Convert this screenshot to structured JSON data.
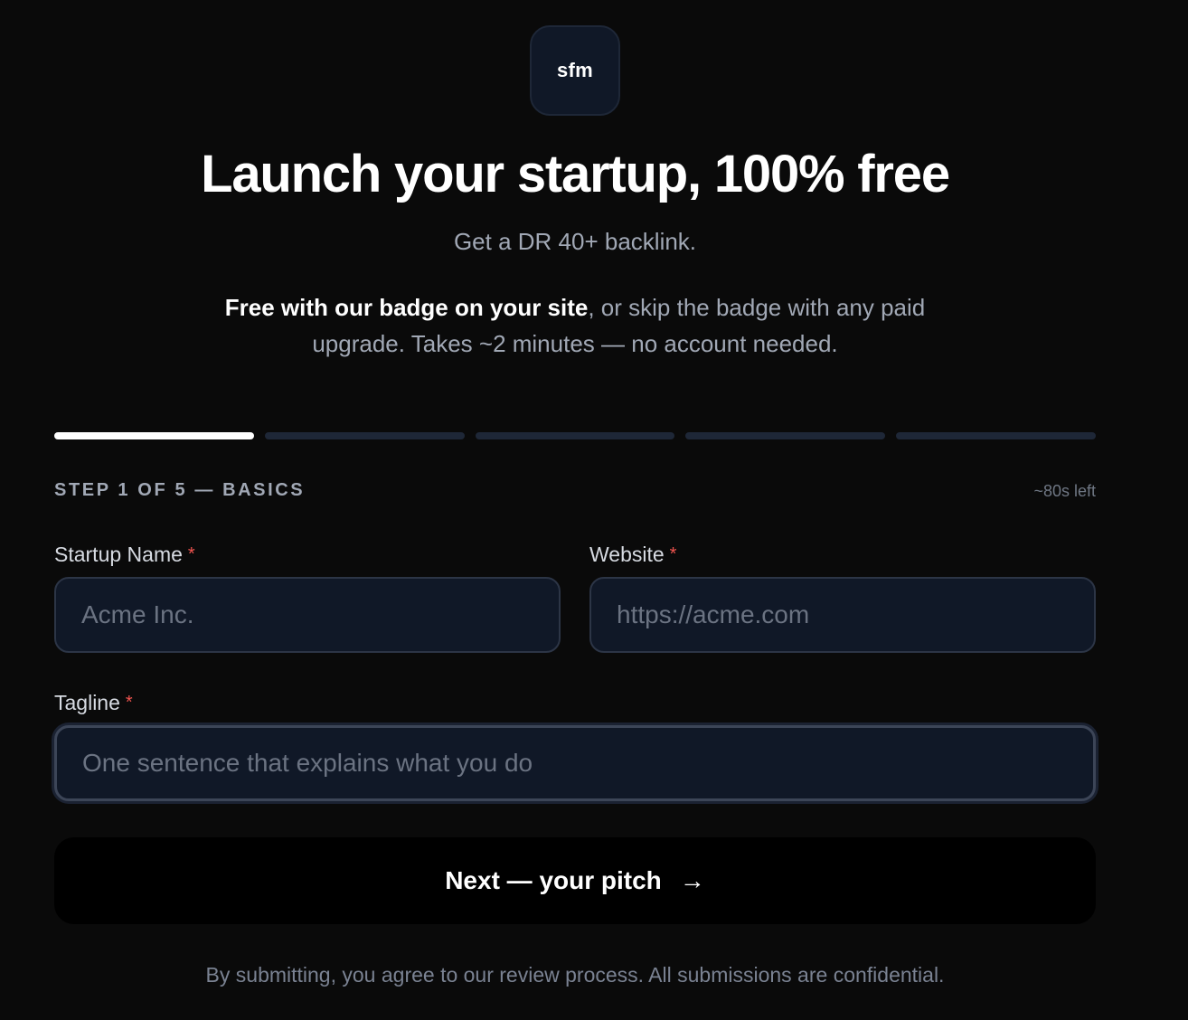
{
  "logo": {
    "text": "sfm"
  },
  "hero": {
    "headline": "Launch your startup, 100% free",
    "subhead": "Get a DR 40+ backlink.",
    "desc_strong": "Free with our badge on your site",
    "desc_rest": ", or skip the badge with any paid upgrade. Takes ~2 minutes — no account needed."
  },
  "progress": {
    "total_steps": 5,
    "current_step": 1
  },
  "step": {
    "label": "STEP 1 OF 5 — BASICS",
    "time_left": "~80s left"
  },
  "form": {
    "required_marker": "*",
    "startup_name": {
      "label": "Startup Name",
      "placeholder": "Acme Inc.",
      "value": ""
    },
    "website": {
      "label": "Website",
      "placeholder": "https://acme.com",
      "value": ""
    },
    "tagline": {
      "label": "Tagline",
      "placeholder": "One sentence that explains what you do",
      "value": ""
    }
  },
  "next_button": {
    "label": "Next — your pitch",
    "icon": "arrow-right-icon"
  },
  "footer": {
    "note": "By submitting, you agree to our review process. All submissions are confidential."
  }
}
